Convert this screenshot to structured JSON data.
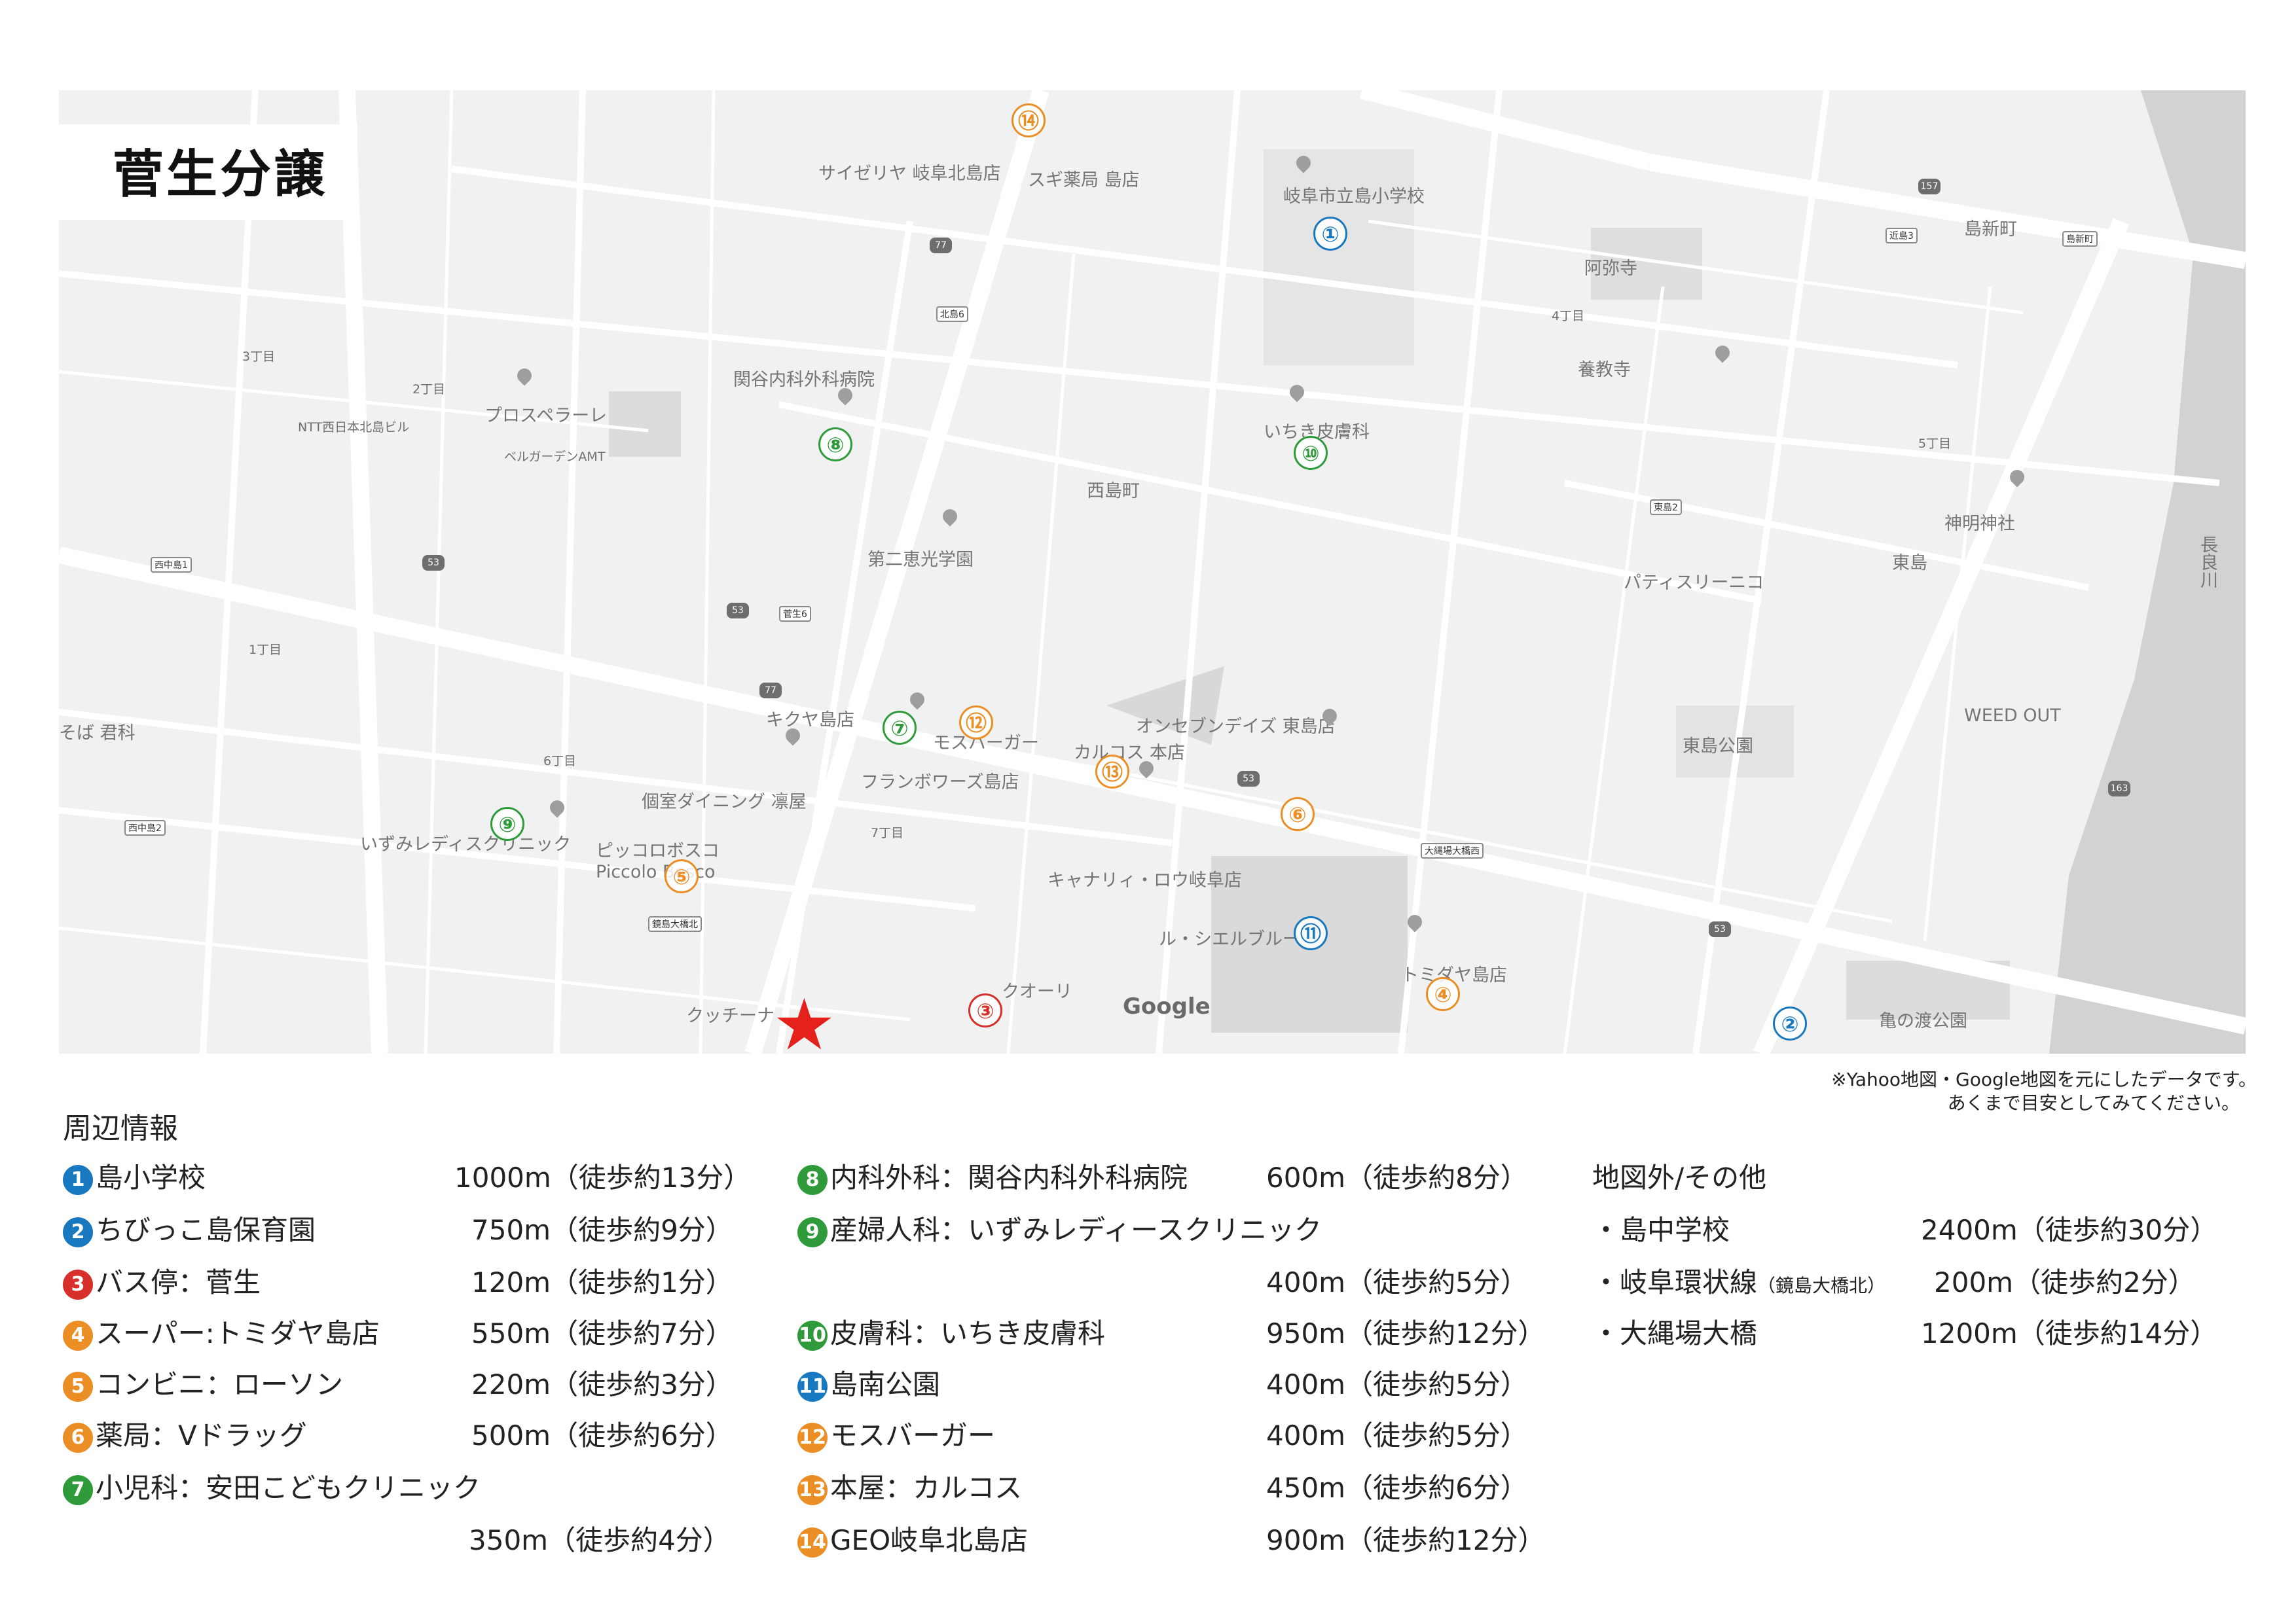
{
  "title": "菅生分譲",
  "map": {
    "attribution": "Google",
    "area_labels": [
      "西島町",
      "東島",
      "島新町",
      "3丁目",
      "2丁目",
      "1丁目",
      "6丁目",
      "7丁目",
      "4丁目",
      "5丁目"
    ],
    "place_labels": [
      {
        "text": "岐阜市立島小学校"
      },
      {
        "text": "関谷内科外科病院"
      },
      {
        "text": "いちき皮膚科"
      },
      {
        "text": "第二恵光学園"
      },
      {
        "text": "キクヤ島店"
      },
      {
        "text": "モスバーガー"
      },
      {
        "text": "フランボワーズ島店"
      },
      {
        "text": "カルコス 本店"
      },
      {
        "text": "オンセブンデイズ 東島店"
      },
      {
        "text": "いずみレディスクリニック"
      },
      {
        "text": "個室ダイニング 凛屋"
      },
      {
        "text": "ピッコロボスコ Piccolo Bosco"
      },
      {
        "text": "キャナリィ・ロウ岐阜店"
      },
      {
        "text": "ル・シエルブルー"
      },
      {
        "text": "トミダヤ島店"
      },
      {
        "text": "クッチーナ"
      },
      {
        "text": "クオーリ"
      },
      {
        "text": "サイゼリヤ 岐阜北島店"
      },
      {
        "text": "スギ薬局 島店"
      },
      {
        "text": "プロスペラーレ"
      },
      {
        "text": "そば 君科"
      },
      {
        "text": "東島公園"
      },
      {
        "text": "WEED OUT"
      },
      {
        "text": "神明神社"
      },
      {
        "text": "阿弥寺"
      },
      {
        "text": "パティスリーニコ"
      },
      {
        "text": "養教寺"
      },
      {
        "text": "長良川"
      },
      {
        "text": "亀の渡公園"
      },
      {
        "text": "ベルガーデンAMT"
      },
      {
        "text": "NTT西日本北島ビル"
      },
      {
        "text": "西中島1"
      },
      {
        "text": "西中島2"
      },
      {
        "text": "菅生6"
      },
      {
        "text": "北島6"
      },
      {
        "text": "鏡島大橋北"
      },
      {
        "text": "大縄場大橋西"
      },
      {
        "text": "東島2"
      },
      {
        "text": "近島3"
      },
      {
        "text": "島新町"
      }
    ],
    "markers": [
      "①",
      "②",
      "③",
      "④",
      "⑤",
      "⑥",
      "⑦",
      "⑧",
      "⑨",
      "⑩",
      "⑪",
      "⑫",
      "⑬",
      "⑭"
    ]
  },
  "note": {
    "line1": "※Yahoo地図・Google地図を元にしたデータです。",
    "line2": "あくまで目安としてみてください。"
  },
  "section_title": "周辺情報",
  "items": [
    {
      "num": "1",
      "label": "島小学校",
      "dist": "1000m（徒歩約13分）"
    },
    {
      "num": "2",
      "label": "ちびっこ島保育園",
      "dist": "750m（徒歩約9分）"
    },
    {
      "num": "3",
      "label": "バス停：菅生",
      "dist": "120m（徒歩約1分）"
    },
    {
      "num": "4",
      "label": "スーパー:トミダヤ島店",
      "dist": "550m（徒歩約7分）"
    },
    {
      "num": "5",
      "label": "コンビニ：ローソン",
      "dist": "220m（徒歩約3分）"
    },
    {
      "num": "6",
      "label": "薬局：Vドラッグ",
      "dist": "500m（徒歩約6分）"
    },
    {
      "num": "7",
      "label": "小児科：安田こどもクリニック",
      "dist": "350m（徒歩約4分）"
    },
    {
      "num": "8",
      "label": "内科外科：関谷内科外科病院",
      "dist": "600m（徒歩約8分）"
    },
    {
      "num": "9",
      "label": "産婦人科：いずみレディースクリニック",
      "dist": "400m（徒歩約5分）"
    },
    {
      "num": "10",
      "label": "皮膚科：いちき皮膚科",
      "dist": "950m（徒歩約12分）"
    },
    {
      "num": "11",
      "label": "島南公園",
      "dist": "400m（徒歩約5分）"
    },
    {
      "num": "12",
      "label": "モスバーガー",
      "dist": "400m（徒歩約5分）"
    },
    {
      "num": "13",
      "label": "本屋：カルコス",
      "dist": "450m（徒歩約6分）"
    },
    {
      "num": "14",
      "label": "GEO岐阜北島店",
      "dist": "900m（徒歩約12分）"
    }
  ],
  "other": {
    "title": "地図外/その他",
    "items": [
      {
        "label": "・島中学校",
        "dist": "2400m（徒歩約30分）"
      },
      {
        "label": "・岐阜環状線",
        "sub": "（鏡島大橋北）",
        "dist": "200m（徒歩約2分）"
      },
      {
        "label": "・大縄場大橋",
        "dist": "1200m（徒歩約14分）"
      }
    ]
  },
  "colors": {
    "blue": "#1878c0",
    "green": "#2f9a3a",
    "red": "#d7302a",
    "orange": "#ea8e25",
    "star": "#e5211c"
  }
}
